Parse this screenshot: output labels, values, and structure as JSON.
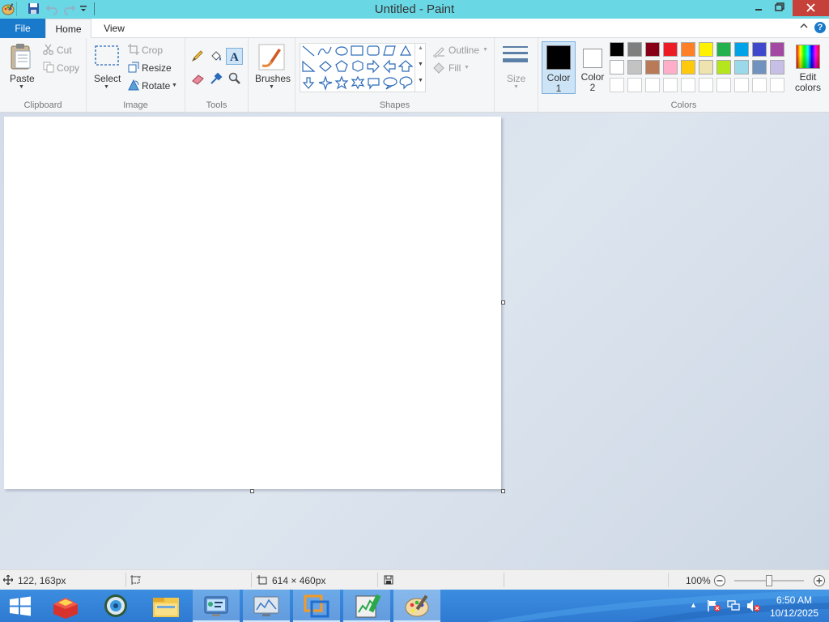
{
  "window": {
    "title": "Untitled - Paint"
  },
  "tabs": {
    "file": "File",
    "home": "Home",
    "view": "View"
  },
  "clipboard": {
    "paste": "Paste",
    "cut": "Cut",
    "copy": "Copy",
    "group": "Clipboard"
  },
  "image": {
    "select": "Select",
    "crop": "Crop",
    "resize": "Resize",
    "rotate": "Rotate",
    "group": "Image"
  },
  "tools": {
    "group": "Tools"
  },
  "brushes": {
    "label": "Brushes"
  },
  "shapes": {
    "outline": "Outline",
    "fill": "Fill",
    "group": "Shapes"
  },
  "size": {
    "label": "Size"
  },
  "colors": {
    "color1_line1": "Color",
    "color1_line2": "1",
    "color2_line1": "Color",
    "color2_line2": "2",
    "edit_line1": "Edit",
    "edit_line2": "colors",
    "group": "Colors",
    "color1_value": "#000000",
    "color2_value": "#ffffff",
    "palette_row1": [
      "#000000",
      "#7f7f7f",
      "#880015",
      "#ed1c24",
      "#ff7f27",
      "#fff200",
      "#22b14c",
      "#00a2e8",
      "#3f48cc",
      "#a349a4"
    ],
    "palette_row2": [
      "#ffffff",
      "#c3c3c3",
      "#b97a57",
      "#ffaec9",
      "#ffc90e",
      "#efe4b0",
      "#b5e61d",
      "#99d9ea",
      "#7092be",
      "#c8bfe7"
    ]
  },
  "status": {
    "cursor_pos": "122, 163px",
    "image_size": "614 × 460px",
    "zoom": "100%"
  },
  "taskbar": {
    "time": "6:50 AM",
    "date": "10/12/2025"
  }
}
